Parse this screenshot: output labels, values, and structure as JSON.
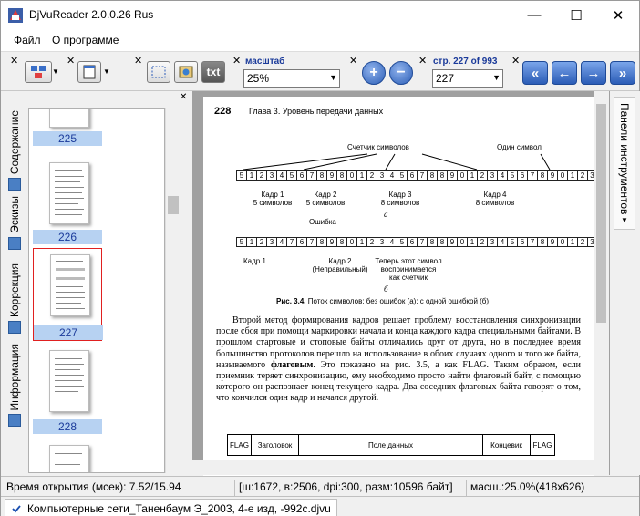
{
  "window": {
    "title": "DjVuReader 2.0.0.26 Rus",
    "minimize": "—",
    "maximize": "☐",
    "close": "✕"
  },
  "menu": {
    "file": "Файл",
    "about": "О программе"
  },
  "toolbar": {
    "zoom_label": "масштаб",
    "zoom_value": "25%",
    "page_label": "стр. 227 of 993",
    "page_value": "227",
    "txt_label": "txt",
    "zoom_in": "+",
    "zoom_out": "−",
    "first": "«",
    "prev": "←",
    "next": "→",
    "last": "»"
  },
  "left_tabs": [
    "Содержание",
    "Эскизы",
    "Коррекция",
    "Информация"
  ],
  "thumbnails": [
    {
      "number": "225"
    },
    {
      "number": "226"
    },
    {
      "number": "227",
      "selected": true
    },
    {
      "number": "228"
    }
  ],
  "right_panel": {
    "label": "Панели инструментов"
  },
  "page": {
    "number": "228",
    "header": "Глава 3. Уровень передачи данных",
    "labels": {
      "counter": "Счетчик символов",
      "one_symbol": "Один символ",
      "frame1": "Кадр 1",
      "frame1_sub": "5 символов",
      "frame2": "Кадр 2",
      "frame2_sub": "5 символов",
      "frame3": "Кадр 3",
      "frame3_sub": "8 символов",
      "frame4": "Кадр 4",
      "frame4_sub": "8 символов",
      "a": "а",
      "error": "Ошибка",
      "b1": "Кадр 1",
      "b2": "Кадр 2",
      "b2_sub": "(Неправильный)",
      "now1": "Теперь этот символ",
      "now2": "воспринимается",
      "now3": "как счетчик",
      "b": "б"
    },
    "row_a": [
      "5",
      "1",
      "2",
      "3",
      "4",
      "5",
      "6",
      "7",
      "8",
      "9",
      "8",
      "0",
      "1",
      "2",
      "3",
      "4",
      "5",
      "6",
      "7",
      "8",
      "8",
      "9",
      "0",
      "1",
      "2",
      "3",
      "4",
      "5",
      "6",
      "7",
      "8",
      "9",
      "0",
      "1",
      "2",
      "3"
    ],
    "row_b": [
      "5",
      "1",
      "2",
      "3",
      "4",
      "7",
      "6",
      "7",
      "8",
      "9",
      "8",
      "0",
      "1",
      "2",
      "3",
      "4",
      "5",
      "6",
      "7",
      "8",
      "8",
      "9",
      "0",
      "1",
      "2",
      "3",
      "4",
      "5",
      "6",
      "7",
      "8",
      "9",
      "0",
      "1",
      "2",
      "3"
    ],
    "caption_bold": "Рис. 3.4.",
    "caption": " Поток символов: без ошибок (а); с одной ошибкой (б)",
    "paragraph_pre": "Второй метод формирования кадров решает проблему восстановления синхронизации после сбоя при помощи маркировки начала и конца каждого кадра специальными байтами. В прошлом стартовые и стоповые байты отличались друг от друга, но в последнее время большинство протоколов перешло на использование в обоих случаях одного и того же байта, называемого ",
    "paragraph_bold": "флаговым",
    "paragraph_post": ". Это показано на рис. 3.5, а как FLAG. Таким образом, если приемник теряет синхронизацию, ему необходимо просто найти флаговый байт, с помощью которого он распознает конец текущего кадра. Два соседних флаговых байта говорят о том, что кончился один кадр и начался другой.",
    "frame_fields": [
      "FLAG",
      "Заголовок",
      "Поле данных",
      "Концевик",
      "FLAG"
    ]
  },
  "status": {
    "open_time": "Время открытия (мсек): 7.52/15.94",
    "info": "[ш:1672, в:2506, dpi:300, разм:10596 байт]",
    "zoom": "масш.:25.0%(418x626)"
  },
  "document_tab": "Компьютерные сети_Таненбаум Э_2003, 4-е изд, -992с.djvu"
}
